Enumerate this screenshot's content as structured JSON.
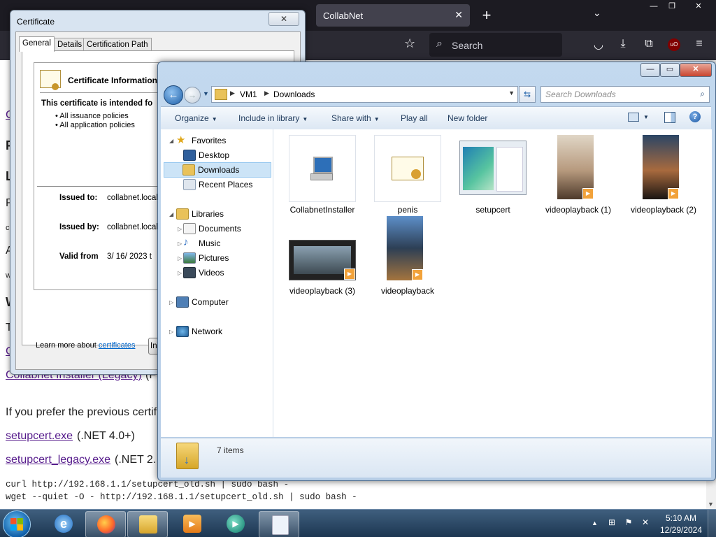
{
  "firefox": {
    "tab_title": "CollabNet",
    "tab_close": "✕",
    "new_tab": "+",
    "list_tabs": "⌄",
    "search_placeholder": "Search",
    "window_min": "—",
    "window_restore": "❐",
    "window_close": "✕"
  },
  "page": {
    "fragments": [
      "C",
      "P",
      "L",
      "R",
      "c",
      "A",
      "w",
      "W",
      "T",
      "C"
    ],
    "collabnet_legacy_link": "Collabnet Installer (Legacy)",
    "collabnet_legacy_suffix": "(F",
    "prefer_text": "If you prefer the previous certif",
    "setupcert_link": "setupcert.exe",
    "setupcert_suffix": "(.NET 4.0+)",
    "setupcert_legacy_link": "setupcert_legacy.exe",
    "setupcert_legacy_suffix": "(.NET 2.",
    "code_line1": "curl http://192.168.1.1/setupcert_old.sh | sudo bash -",
    "code_line2": "wget --quiet -O - http://192.168.1.1/setupcert_old.sh | sudo bash -"
  },
  "certificate": {
    "title": "Certificate",
    "close": "✕",
    "tabs": [
      "General",
      "Details",
      "Certification Path"
    ],
    "info_title": "Certificate Information",
    "intended_for": "This certificate is intended fo",
    "bullets": [
      "• All issuance policies",
      "• All application policies"
    ],
    "issued_to_label": "Issued to:",
    "issued_to_value": "collabnet.local",
    "issued_by_label": "Issued by:",
    "issued_by_value": "collabnet.local",
    "valid_from_label": "Valid from",
    "valid_from_value": "3/ 16/ 2023  t",
    "install_button": "Insta",
    "learn_more_prefix": "Learn more about ",
    "learn_more_link": "certificates"
  },
  "explorer": {
    "window_min": "—",
    "window_max": "▭",
    "window_close": "✕",
    "breadcrumb": [
      "VM1",
      "Downloads"
    ],
    "search_placeholder": "Search Downloads",
    "commands": {
      "organize": "Organize",
      "include_in_library": "Include in library",
      "share_with": "Share with",
      "play_all": "Play all",
      "new_folder": "New folder",
      "help": "?"
    },
    "nav": {
      "favorites": "Favorites",
      "desktop": "Desktop",
      "downloads": "Downloads",
      "recent_places": "Recent Places",
      "libraries": "Libraries",
      "documents": "Documents",
      "music": "Music",
      "pictures": "Pictures",
      "videos": "Videos",
      "computer": "Computer",
      "network": "Network"
    },
    "files": [
      {
        "name": "CollabnetInstaller",
        "icon": "installer-icon"
      },
      {
        "name": "penis",
        "icon": "certificate-file-icon"
      },
      {
        "name": "setupcert",
        "icon": "setupcert-thumbnail"
      },
      {
        "name": "videoplayback (1)",
        "icon": "video-thumbnail"
      },
      {
        "name": "videoplayback (2)",
        "icon": "video-thumbnail"
      },
      {
        "name": "videoplayback (3)",
        "icon": "video-thumbnail"
      },
      {
        "name": "videoplayback",
        "icon": "video-thumbnail"
      }
    ],
    "item_count": "7 items"
  },
  "taskbar": {
    "time": "5:10 AM",
    "date": "12/29/2024",
    "apps": [
      "internet-explorer",
      "firefox",
      "windows-explorer",
      "media-player",
      "media-center",
      "notepad"
    ]
  }
}
